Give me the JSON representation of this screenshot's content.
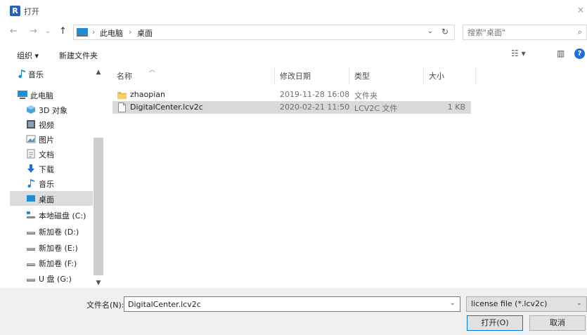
{
  "window": {
    "logo": "R",
    "title": "打开",
    "close": "×"
  },
  "nav": {
    "back": "←",
    "forward": "→",
    "history": "⌄",
    "up": "↑",
    "breadcrumb": [
      "此电脑",
      "桌面"
    ],
    "separator": "›",
    "search_placeholder": "搜索\"桌面\"",
    "refresh": "↻"
  },
  "toolbar": {
    "organize": "组织 ▾",
    "new_folder": "新建文件夹",
    "help": "?"
  },
  "sidebar": {
    "items": [
      {
        "label": "音乐",
        "icon": "music-icon"
      },
      {
        "label": "此电脑",
        "icon": "computer-icon"
      },
      {
        "label": "3D 对象",
        "icon": "3d-objects-icon"
      },
      {
        "label": "视频",
        "icon": "video-icon"
      },
      {
        "label": "图片",
        "icon": "picture-icon"
      },
      {
        "label": "文档",
        "icon": "document-icon"
      },
      {
        "label": "下载",
        "icon": "download-icon"
      },
      {
        "label": "音乐",
        "icon": "music-icon"
      },
      {
        "label": "桌面",
        "icon": "desktop-icon",
        "selected": true
      },
      {
        "label": "本地磁盘 (C:)",
        "icon": "system-drive-icon"
      },
      {
        "label": "新加卷 (D:)",
        "icon": "drive-icon"
      },
      {
        "label": "新加卷 (E:)",
        "icon": "drive-icon"
      },
      {
        "label": "新加卷 (F:)",
        "icon": "drive-icon"
      },
      {
        "label": "U 盘 (G:)",
        "icon": "usb-drive-icon"
      }
    ]
  },
  "list": {
    "columns": {
      "name": "名称",
      "date": "修改日期",
      "type": "类型",
      "size": "大小"
    },
    "rows": [
      {
        "name": "zhaopian",
        "date": "2019-11-28 16:08",
        "type": "文件夹",
        "size": "",
        "icon": "folder-icon"
      },
      {
        "name": "DigitalCenter.lcv2c",
        "date": "2020-02-21 11:50",
        "type": "LCV2C 文件",
        "size": "1 KB",
        "icon": "file-icon",
        "selected": true
      }
    ]
  },
  "footer": {
    "filename_label": "文件名(N):",
    "filename_value": "DigitalCenter.lcv2c",
    "filter": "license file (*.lcv2c)",
    "open_button": "打开(O)",
    "cancel_button": "取消"
  },
  "colors": {
    "accent": "#0078d7",
    "folder": "#e8b84a",
    "selected_bg": "#d9d9d9"
  }
}
